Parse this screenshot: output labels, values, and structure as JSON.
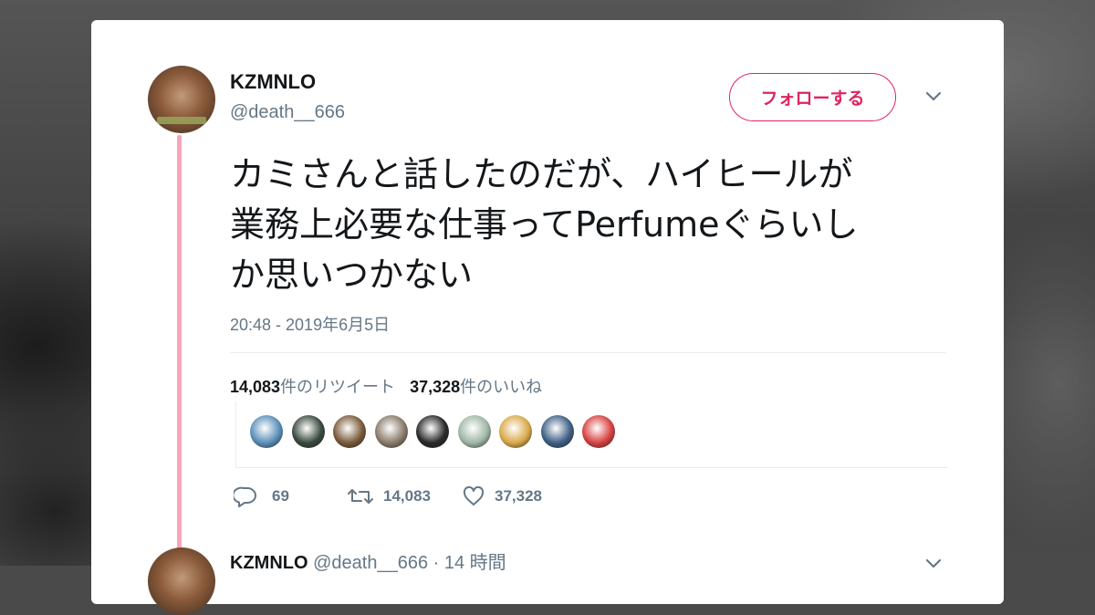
{
  "user": {
    "display_name": "KZMNLO",
    "handle": "@death__666"
  },
  "follow_button": {
    "label": "フォローする"
  },
  "tweet": {
    "line1": "カミさんと話したのだが、ハイヒールが",
    "line2": "業務上必要な仕事ってPerfumeぐらいし",
    "line3": "か思いつかない",
    "timestamp": "20:48 - 2019年6月5日"
  },
  "stats": {
    "retweet_count": "14,083",
    "retweet_label": "件のリツイート",
    "like_count": "37,328",
    "like_label": "件のいいね"
  },
  "likers": [
    {
      "color": "#5b8fb8"
    },
    {
      "color": "#3a4a3e"
    },
    {
      "color": "#7a5a3a"
    },
    {
      "color": "#8a7a6a"
    },
    {
      "color": "#2a2a2a"
    },
    {
      "color": "#9fb7a6"
    },
    {
      "color": "#d9a84a"
    },
    {
      "color": "#3f5f85"
    },
    {
      "color": "#d84040"
    }
  ],
  "actions": {
    "reply_count": "69",
    "retweet_count": "14,083",
    "like_count": "37,328"
  },
  "reply": {
    "display_name": "KZMNLO",
    "handle": "@death__666",
    "time": "· 14 時間"
  },
  "colors": {
    "accent": "#e0245e",
    "thread_line": "#f6a6b9",
    "muted": "#657786",
    "text": "#14171a"
  }
}
